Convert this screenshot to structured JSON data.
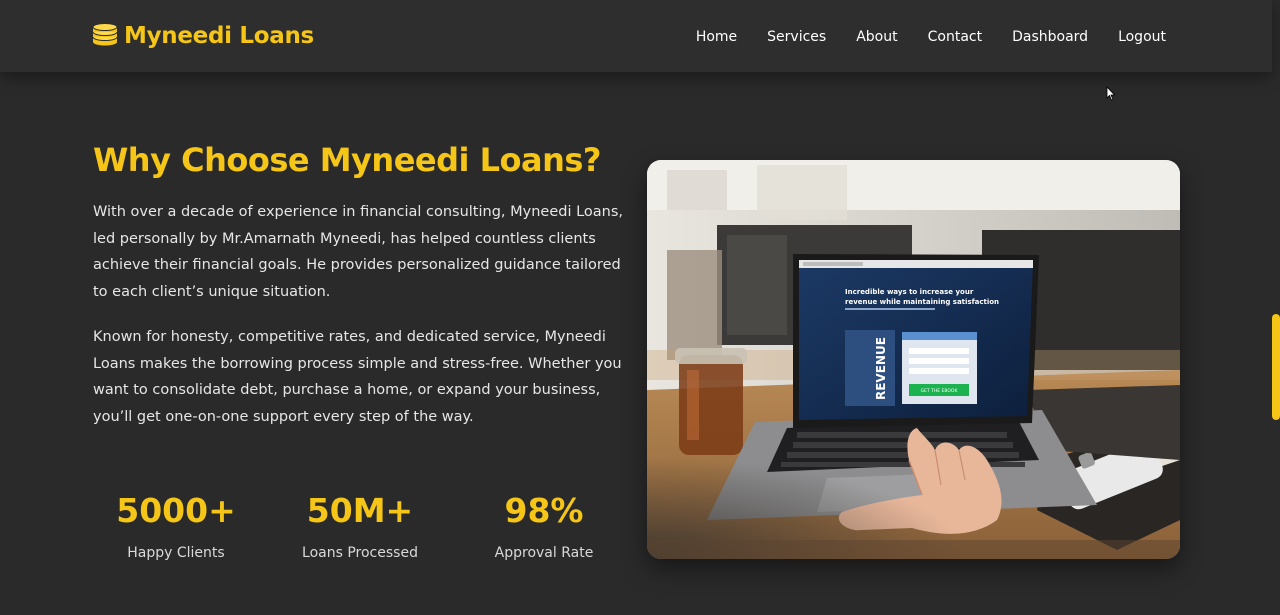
{
  "brand": {
    "name": "Myneedi Loans",
    "icon": "coins-icon",
    "color": "#f5c518"
  },
  "nav": {
    "items": [
      {
        "label": "Home"
      },
      {
        "label": "Services"
      },
      {
        "label": "About"
      },
      {
        "label": "Contact"
      },
      {
        "label": "Dashboard"
      },
      {
        "label": "Logout"
      }
    ]
  },
  "section": {
    "title": "Why Choose Myneedi Loans?",
    "paragraphs": [
      "With over a decade of experience in financial consulting, Myneedi Loans, led personally by Mr.Amarnath Myneedi, has helped countless clients achieve their financial goals. He provides personalized guidance tailored to each client’s unique situation.",
      "Known for honesty, competitive rates, and dedicated service, Myneedi Loans makes the borrowing process simple and stress-free. Whether you want to consolidate debt, purchase a home, or expand your business, you’ll get one-on-one support every step of the way."
    ]
  },
  "stats": [
    {
      "value": "5000+",
      "label": "Happy Clients"
    },
    {
      "value": "50M+",
      "label": "Loans Processed"
    },
    {
      "value": "98%",
      "label": "Approval Rate"
    }
  ],
  "photo": {
    "screen_headline_1": "Incredible ways to increase your",
    "screen_headline_2": "revenue while maintaining satisfaction",
    "screen_side_word": "REVENUE",
    "screen_button": "GET THE EBOOK"
  },
  "theme": {
    "accent": "#f5c518",
    "background": "#2a2a2a",
    "navbar": "#2e2e2e"
  }
}
